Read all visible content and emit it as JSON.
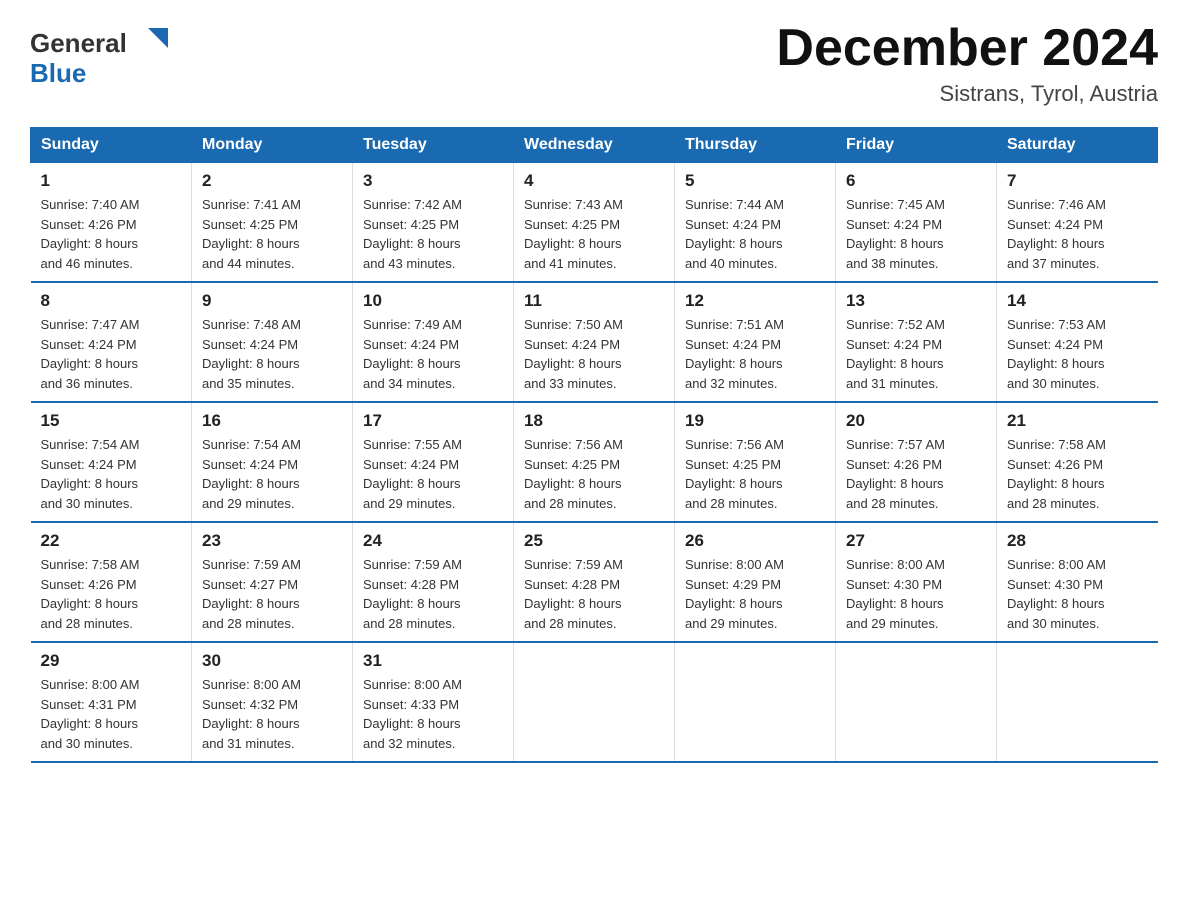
{
  "logo": {
    "general": "General",
    "blue": "Blue",
    "triangle_desc": "blue triangle logo mark"
  },
  "title": {
    "month_year": "December 2024",
    "location": "Sistrans, Tyrol, Austria"
  },
  "days_of_week": [
    "Sunday",
    "Monday",
    "Tuesday",
    "Wednesday",
    "Thursday",
    "Friday",
    "Saturday"
  ],
  "weeks": [
    [
      {
        "day": "1",
        "sunrise": "7:40 AM",
        "sunset": "4:26 PM",
        "daylight": "8 hours and 46 minutes."
      },
      {
        "day": "2",
        "sunrise": "7:41 AM",
        "sunset": "4:25 PM",
        "daylight": "8 hours and 44 minutes."
      },
      {
        "day": "3",
        "sunrise": "7:42 AM",
        "sunset": "4:25 PM",
        "daylight": "8 hours and 43 minutes."
      },
      {
        "day": "4",
        "sunrise": "7:43 AM",
        "sunset": "4:25 PM",
        "daylight": "8 hours and 41 minutes."
      },
      {
        "day": "5",
        "sunrise": "7:44 AM",
        "sunset": "4:24 PM",
        "daylight": "8 hours and 40 minutes."
      },
      {
        "day": "6",
        "sunrise": "7:45 AM",
        "sunset": "4:24 PM",
        "daylight": "8 hours and 38 minutes."
      },
      {
        "day": "7",
        "sunrise": "7:46 AM",
        "sunset": "4:24 PM",
        "daylight": "8 hours and 37 minutes."
      }
    ],
    [
      {
        "day": "8",
        "sunrise": "7:47 AM",
        "sunset": "4:24 PM",
        "daylight": "8 hours and 36 minutes."
      },
      {
        "day": "9",
        "sunrise": "7:48 AM",
        "sunset": "4:24 PM",
        "daylight": "8 hours and 35 minutes."
      },
      {
        "day": "10",
        "sunrise": "7:49 AM",
        "sunset": "4:24 PM",
        "daylight": "8 hours and 34 minutes."
      },
      {
        "day": "11",
        "sunrise": "7:50 AM",
        "sunset": "4:24 PM",
        "daylight": "8 hours and 33 minutes."
      },
      {
        "day": "12",
        "sunrise": "7:51 AM",
        "sunset": "4:24 PM",
        "daylight": "8 hours and 32 minutes."
      },
      {
        "day": "13",
        "sunrise": "7:52 AM",
        "sunset": "4:24 PM",
        "daylight": "8 hours and 31 minutes."
      },
      {
        "day": "14",
        "sunrise": "7:53 AM",
        "sunset": "4:24 PM",
        "daylight": "8 hours and 30 minutes."
      }
    ],
    [
      {
        "day": "15",
        "sunrise": "7:54 AM",
        "sunset": "4:24 PM",
        "daylight": "8 hours and 30 minutes."
      },
      {
        "day": "16",
        "sunrise": "7:54 AM",
        "sunset": "4:24 PM",
        "daylight": "8 hours and 29 minutes."
      },
      {
        "day": "17",
        "sunrise": "7:55 AM",
        "sunset": "4:24 PM",
        "daylight": "8 hours and 29 minutes."
      },
      {
        "day": "18",
        "sunrise": "7:56 AM",
        "sunset": "4:25 PM",
        "daylight": "8 hours and 28 minutes."
      },
      {
        "day": "19",
        "sunrise": "7:56 AM",
        "sunset": "4:25 PM",
        "daylight": "8 hours and 28 minutes."
      },
      {
        "day": "20",
        "sunrise": "7:57 AM",
        "sunset": "4:26 PM",
        "daylight": "8 hours and 28 minutes."
      },
      {
        "day": "21",
        "sunrise": "7:58 AM",
        "sunset": "4:26 PM",
        "daylight": "8 hours and 28 minutes."
      }
    ],
    [
      {
        "day": "22",
        "sunrise": "7:58 AM",
        "sunset": "4:26 PM",
        "daylight": "8 hours and 28 minutes."
      },
      {
        "day": "23",
        "sunrise": "7:59 AM",
        "sunset": "4:27 PM",
        "daylight": "8 hours and 28 minutes."
      },
      {
        "day": "24",
        "sunrise": "7:59 AM",
        "sunset": "4:28 PM",
        "daylight": "8 hours and 28 minutes."
      },
      {
        "day": "25",
        "sunrise": "7:59 AM",
        "sunset": "4:28 PM",
        "daylight": "8 hours and 28 minutes."
      },
      {
        "day": "26",
        "sunrise": "8:00 AM",
        "sunset": "4:29 PM",
        "daylight": "8 hours and 29 minutes."
      },
      {
        "day": "27",
        "sunrise": "8:00 AM",
        "sunset": "4:30 PM",
        "daylight": "8 hours and 29 minutes."
      },
      {
        "day": "28",
        "sunrise": "8:00 AM",
        "sunset": "4:30 PM",
        "daylight": "8 hours and 30 minutes."
      }
    ],
    [
      {
        "day": "29",
        "sunrise": "8:00 AM",
        "sunset": "4:31 PM",
        "daylight": "8 hours and 30 minutes."
      },
      {
        "day": "30",
        "sunrise": "8:00 AM",
        "sunset": "4:32 PM",
        "daylight": "8 hours and 31 minutes."
      },
      {
        "day": "31",
        "sunrise": "8:00 AM",
        "sunset": "4:33 PM",
        "daylight": "8 hours and 32 minutes."
      },
      null,
      null,
      null,
      null
    ]
  ],
  "labels": {
    "sunrise": "Sunrise:",
    "sunset": "Sunset:",
    "daylight": "Daylight:"
  }
}
